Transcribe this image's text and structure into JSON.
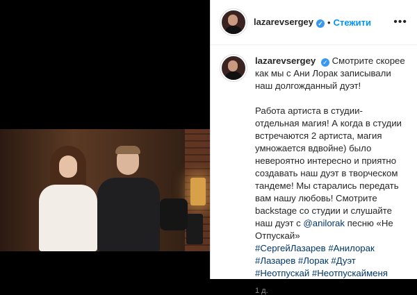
{
  "post": {
    "username": "lazarevsergey",
    "verified_symbol": "✓",
    "separator": "•",
    "follow_label": "Стежити",
    "more_symbol": "•••",
    "caption_intro": "Смотрите скорее как мы с Ани Лорак записывали наш долгожданный дуэт!",
    "caption_lines": [
      "Работа артиста в студии- отдельная магия! А когда в студии встречаются 2 артиста, магия умножается вдвойне) было невероятно интересно и приятно создавать наш дуэт в творческом тандеме! Мы старались передать вам нашу любовь! Смотрите backstage со студии и слушайте наш дуэт с ",
      "@anilorak",
      " песню «Не Отпускай»"
    ],
    "hashtags": [
      "#СергейЛазарев",
      "#Анилорак",
      "#Лазарев",
      "#Лорак",
      "#Дуэт",
      "#Неотпускай",
      "#Неотпускайменя"
    ],
    "time_ago": "1 д."
  },
  "colors": {
    "accent": "#0095f6",
    "link": "#00376b",
    "verified": "#3897f0",
    "text": "#262626",
    "muted": "#8e8e8e"
  }
}
